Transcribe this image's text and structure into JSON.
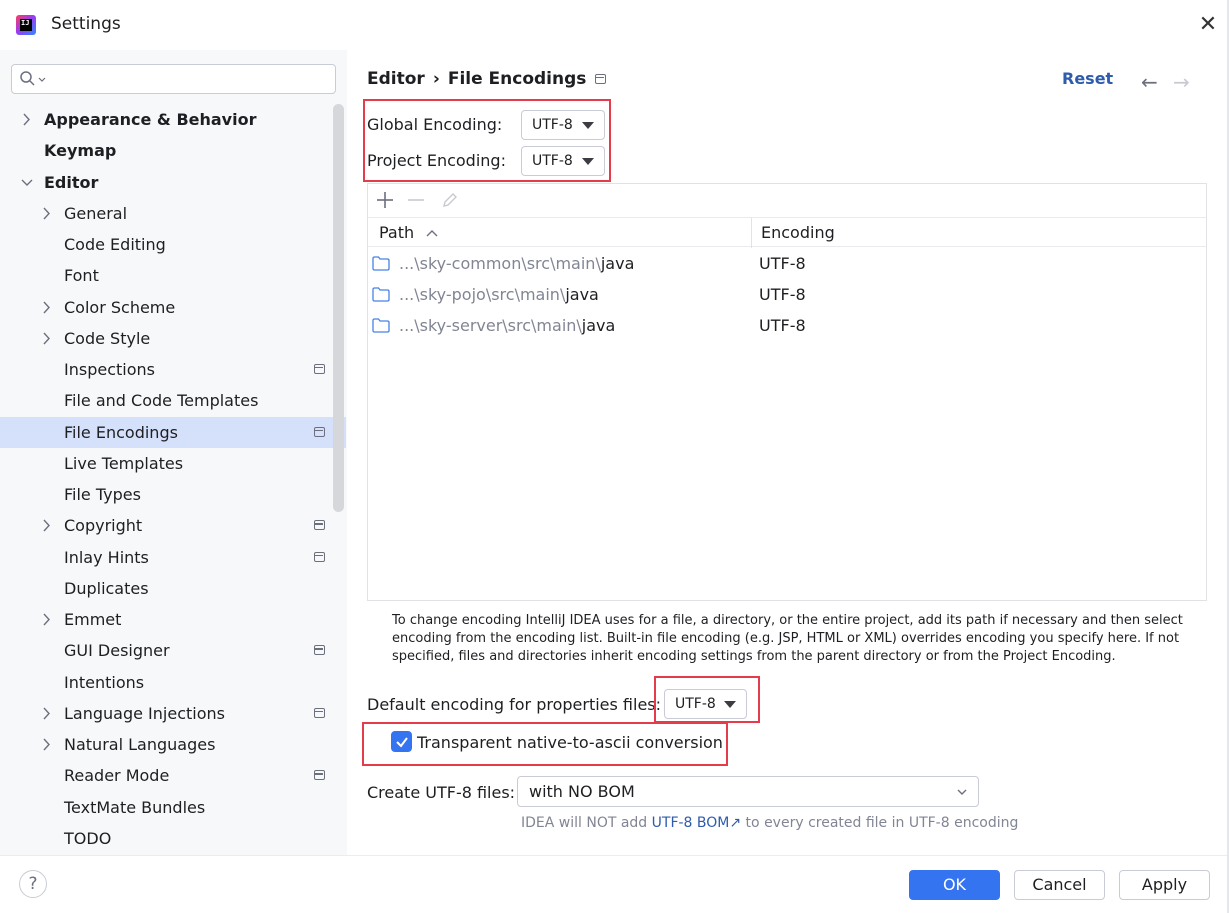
{
  "window": {
    "title": "Settings",
    "logo_text": "IJ"
  },
  "sidebar": {
    "search_placeholder": "",
    "items": [
      {
        "label": "Appearance & Behavior",
        "level": 0,
        "bold": true,
        "chevron": "right",
        "badge": false
      },
      {
        "label": "Keymap",
        "level": 0,
        "bold": true,
        "chevron": "none",
        "badge": false
      },
      {
        "label": "Editor",
        "level": 0,
        "bold": true,
        "chevron": "down",
        "badge": false
      },
      {
        "label": "General",
        "level": 1,
        "bold": false,
        "chevron": "right",
        "badge": false
      },
      {
        "label": "Code Editing",
        "level": 1,
        "bold": false,
        "chevron": "none",
        "badge": false
      },
      {
        "label": "Font",
        "level": 1,
        "bold": false,
        "chevron": "none",
        "badge": false
      },
      {
        "label": "Color Scheme",
        "level": 1,
        "bold": false,
        "chevron": "right",
        "badge": false
      },
      {
        "label": "Code Style",
        "level": 1,
        "bold": false,
        "chevron": "right",
        "badge": false
      },
      {
        "label": "Inspections",
        "level": 1,
        "bold": false,
        "chevron": "none",
        "badge": true
      },
      {
        "label": "File and Code Templates",
        "level": 1,
        "bold": false,
        "chevron": "none",
        "badge": false
      },
      {
        "label": "File Encodings",
        "level": 1,
        "bold": false,
        "chevron": "none",
        "badge": true,
        "selected": true
      },
      {
        "label": "Live Templates",
        "level": 1,
        "bold": false,
        "chevron": "none",
        "badge": false
      },
      {
        "label": "File Types",
        "level": 1,
        "bold": false,
        "chevron": "none",
        "badge": false
      },
      {
        "label": "Copyright",
        "level": 1,
        "bold": false,
        "chevron": "right",
        "badge": true
      },
      {
        "label": "Inlay Hints",
        "level": 1,
        "bold": false,
        "chevron": "none",
        "badge": true
      },
      {
        "label": "Duplicates",
        "level": 1,
        "bold": false,
        "chevron": "none",
        "badge": false
      },
      {
        "label": "Emmet",
        "level": 1,
        "bold": false,
        "chevron": "right",
        "badge": false
      },
      {
        "label": "GUI Designer",
        "level": 1,
        "bold": false,
        "chevron": "none",
        "badge": true
      },
      {
        "label": "Intentions",
        "level": 1,
        "bold": false,
        "chevron": "none",
        "badge": false
      },
      {
        "label": "Language Injections",
        "level": 1,
        "bold": false,
        "chevron": "right",
        "badge": true
      },
      {
        "label": "Natural Languages",
        "level": 1,
        "bold": false,
        "chevron": "right",
        "badge": false
      },
      {
        "label": "Reader Mode",
        "level": 1,
        "bold": false,
        "chevron": "none",
        "badge": true
      },
      {
        "label": "TextMate Bundles",
        "level": 1,
        "bold": false,
        "chevron": "none",
        "badge": false
      },
      {
        "label": "TODO",
        "level": 1,
        "bold": false,
        "chevron": "none",
        "badge": false
      }
    ]
  },
  "header": {
    "crumb_parent": "Editor",
    "crumb_sep": "›",
    "crumb_current": "File Encodings",
    "reset_label": "Reset",
    "back_glyph": "←",
    "forward_glyph": "→"
  },
  "encodings": {
    "global_label": "Global Encoding:",
    "global_value": "UTF-8",
    "project_label": "Project Encoding:",
    "project_value": "UTF-8"
  },
  "table": {
    "col_path": "Path",
    "col_encoding": "Encoding",
    "rows": [
      {
        "path_dim": "...\\sky-common\\src\\main\\",
        "path_main": "java",
        "encoding": "UTF-8"
      },
      {
        "path_dim": "...\\sky-pojo\\src\\main\\",
        "path_main": "java",
        "encoding": "UTF-8"
      },
      {
        "path_dim": "...\\sky-server\\src\\main\\",
        "path_main": "java",
        "encoding": "UTF-8"
      }
    ]
  },
  "help_text": "To change encoding IntelliJ IDEA uses for a file, a directory, or the entire project, add its path if necessary and then select encoding from the encoding list. Built-in file encoding (e.g. JSP, HTML or XML) overrides encoding you specify here. If not specified, files and directories inherit encoding settings from the parent directory or from the Project Encoding.",
  "properties": {
    "label": "Default encoding for properties files:",
    "value": "UTF-8",
    "native_ascii_label": "Transparent native-to-ascii conversion",
    "native_ascii_checked": true
  },
  "utf8": {
    "label": "Create UTF-8 files:",
    "value": "with NO BOM",
    "hint_pre": "IDEA will NOT add ",
    "hint_link": "UTF-8 BOM",
    "hint_link_arrow": "↗",
    "hint_post": " to every created file in UTF-8 encoding"
  },
  "buttons": {
    "help": "?",
    "ok": "OK",
    "cancel": "Cancel",
    "apply": "Apply"
  },
  "colors": {
    "accent": "#3574f0",
    "link": "#2e5bab",
    "highlight_box": "#e53c4b",
    "selection": "#d5e1fb"
  }
}
